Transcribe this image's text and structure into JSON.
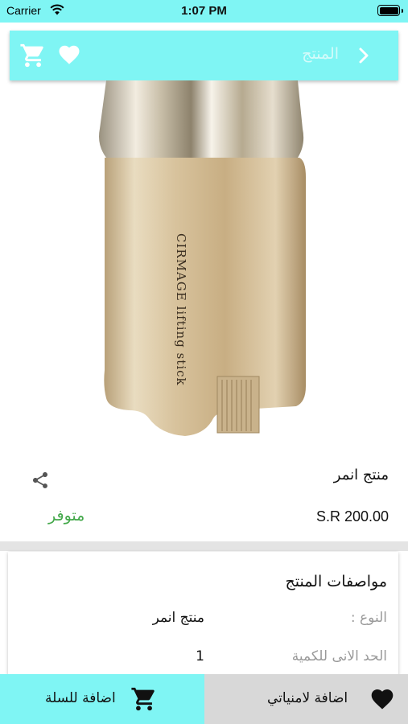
{
  "status_bar": {
    "carrier": "Carrier",
    "time": "1:07 PM"
  },
  "nav": {
    "title": "المنتج"
  },
  "product": {
    "name": "منتج انمر",
    "price": "S.R 200.00",
    "stock": "متوفر",
    "image_brand_text": "CIRMAGE lifting stick"
  },
  "specs": {
    "title": "مواصفات المنتج",
    "rows": [
      {
        "label": "النوع :",
        "value": "منتج انمر"
      },
      {
        "label": "الحد الانى للكمية",
        "value": "1"
      }
    ]
  },
  "bottom": {
    "add_to_cart": "اضافة للسلة",
    "add_to_wishlist": "اضافة لامنياتي"
  },
  "colors": {
    "accent": "#7ff5f4",
    "stock": "#43a84a",
    "muted": "#9a9a9a",
    "secondary_button": "#d8d8d8"
  },
  "icons": [
    "wifi-icon",
    "battery-icon",
    "cart-icon",
    "heart-icon",
    "chevron-right-icon",
    "share-icon"
  ]
}
